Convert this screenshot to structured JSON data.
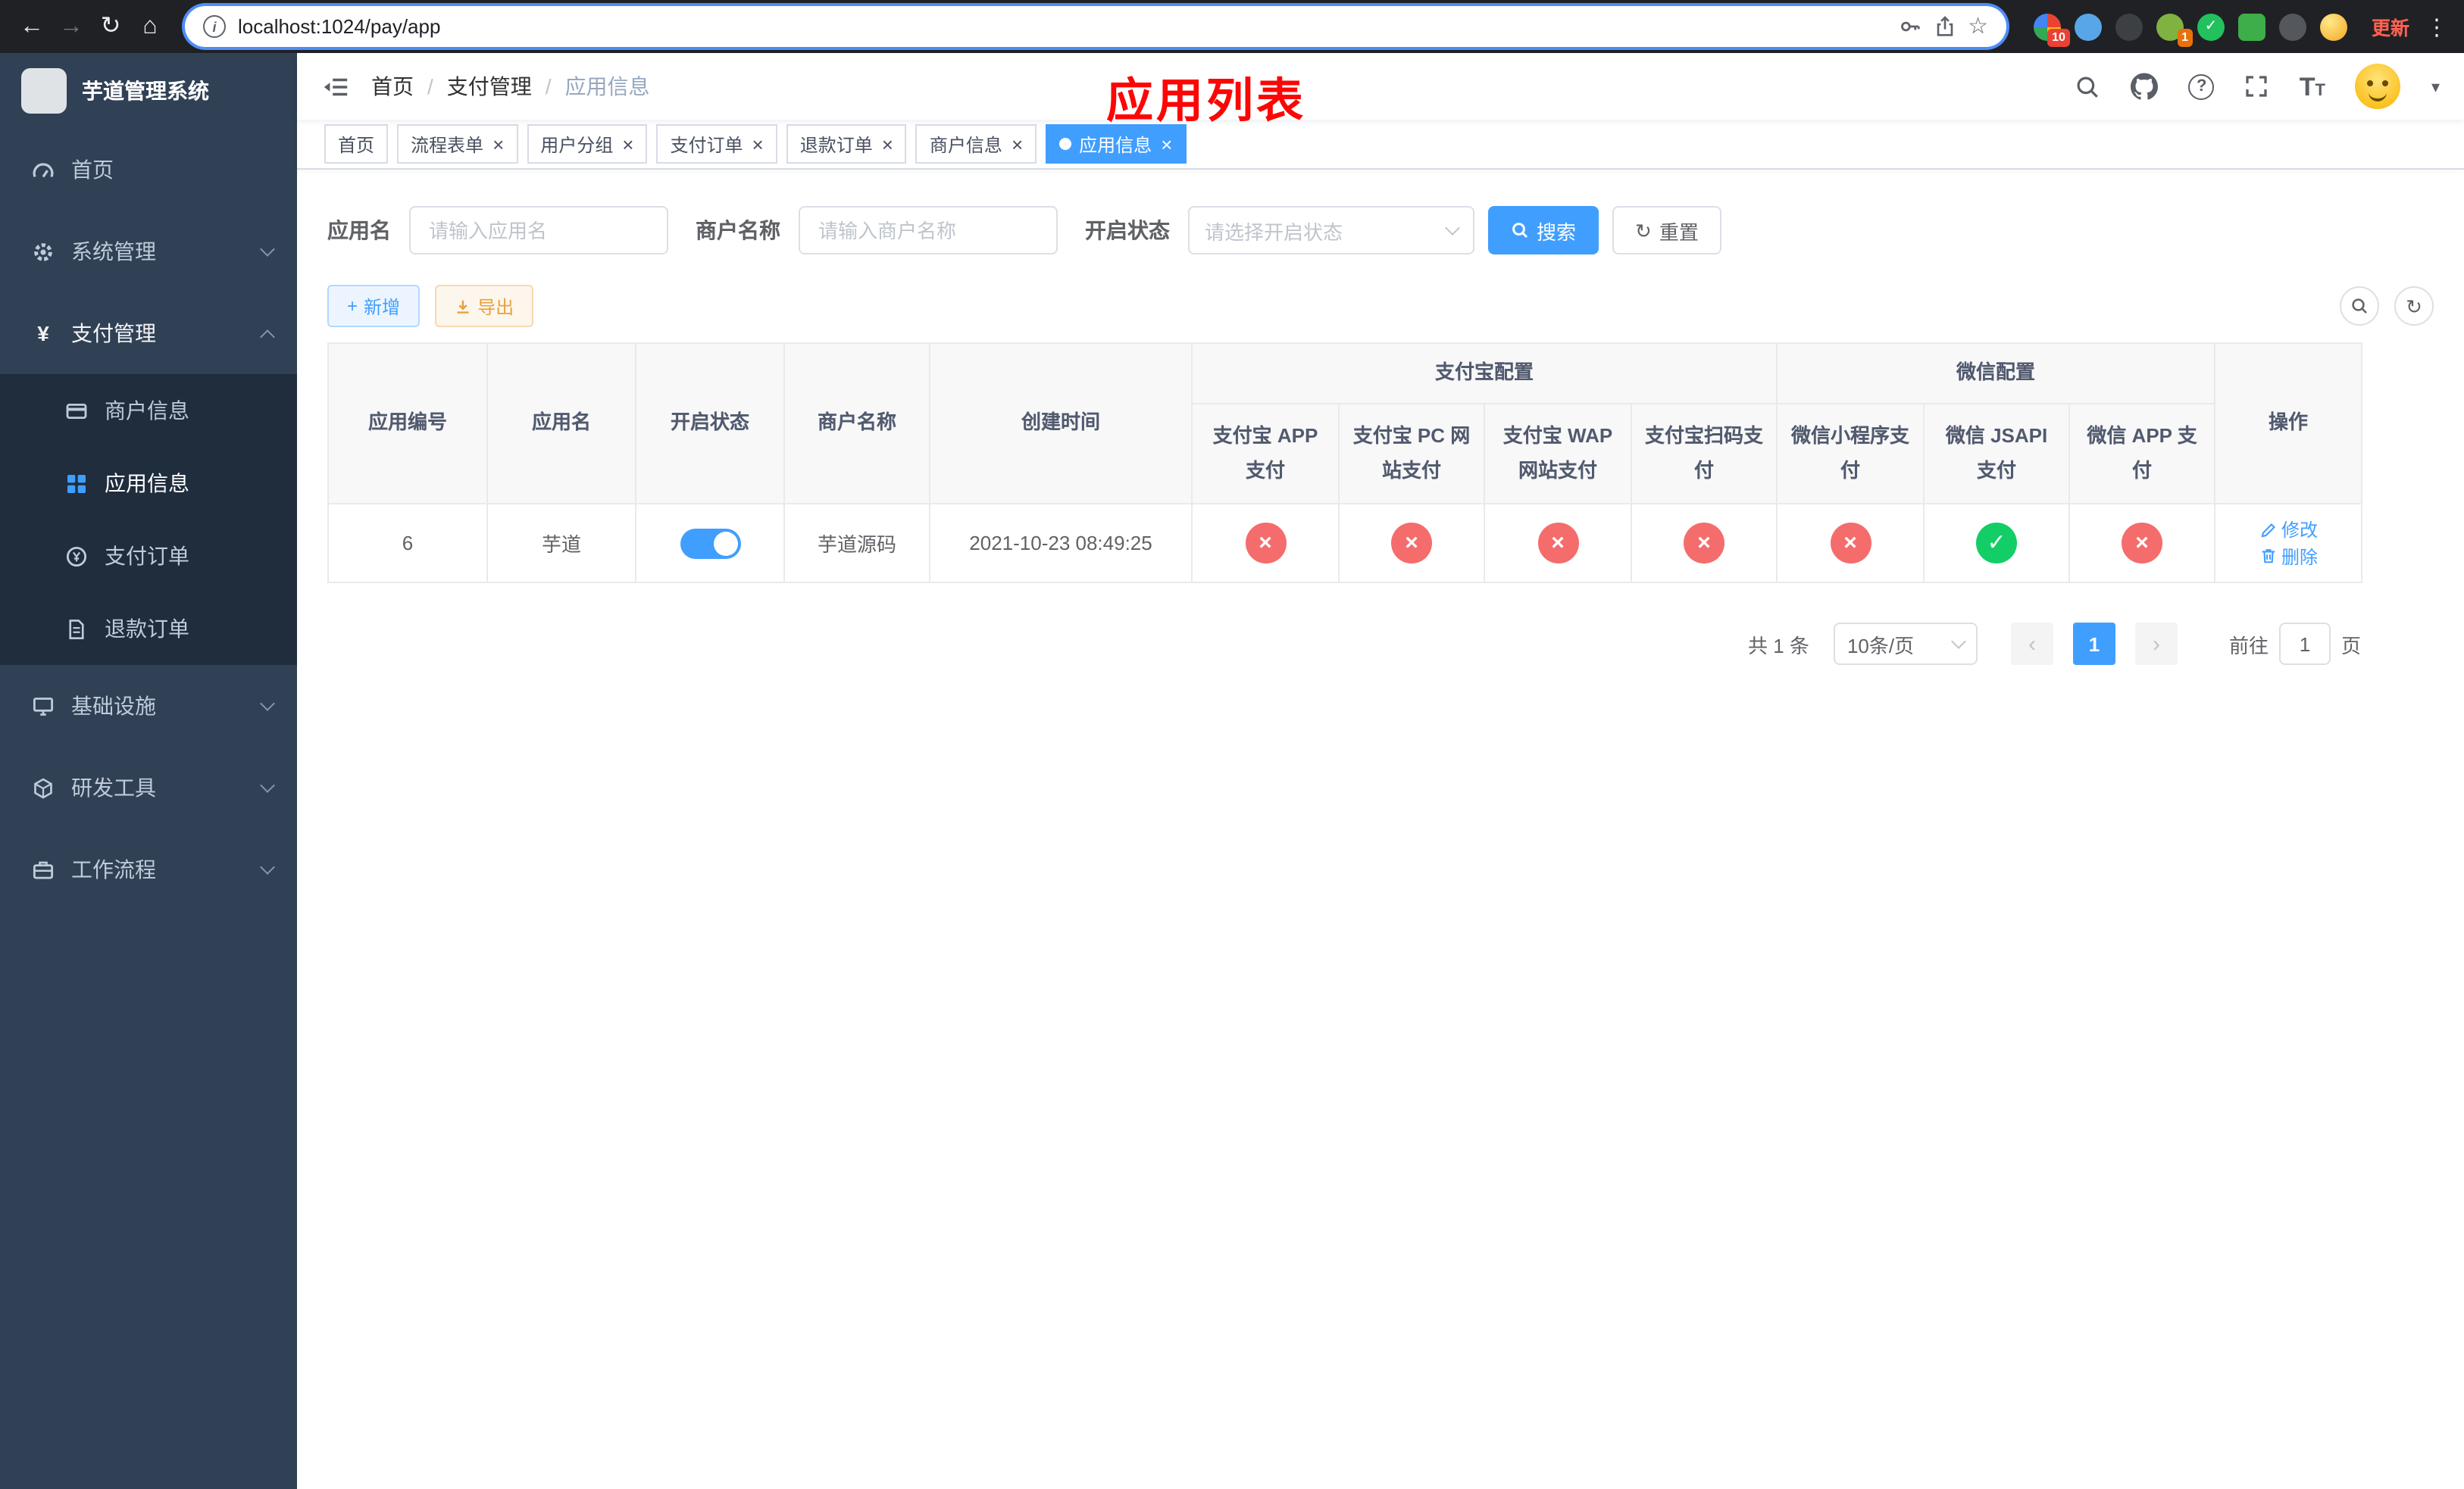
{
  "colors": {
    "accent": "#409eff",
    "success": "#13ce66",
    "danger": "#f56c6c",
    "warning": "#e6a23c"
  },
  "icons": {
    "back": "←",
    "forward": "→",
    "reload": "↻",
    "home": "⌂",
    "menu_dots": "⋮",
    "star": "☆",
    "info": "i",
    "question": "?",
    "plus": "+",
    "refresh": "↻",
    "check": "✓",
    "cross": "×",
    "caret_down": "▾",
    "yen": "¥",
    "prev": "‹",
    "next": "›"
  },
  "browser": {
    "url": "localhost:1024/pay/app",
    "update_label": "更新",
    "extension_badges": [
      "10",
      "1"
    ]
  },
  "sidebar": {
    "title": "芋道管理系统",
    "home": "首页",
    "system": "系统管理",
    "payment": "支付管理",
    "merchant_info": "商户信息",
    "app_info": "应用信息",
    "pay_order": "支付订单",
    "refund_order": "退款订单",
    "infra": "基础设施",
    "dev_tools": "研发工具",
    "workflow": "工作流程"
  },
  "navbar": {
    "breadcrumb": {
      "home": "首页",
      "section": "支付管理",
      "current": "应用信息"
    }
  },
  "annotation": {
    "title": "应用列表",
    "color": "#fe0505"
  },
  "tabs": {
    "home": "首页",
    "process_form": "流程表单",
    "user_group": "用户分组",
    "pay_order": "支付订单",
    "refund_order": "退款订单",
    "merchant_info": "商户信息",
    "app_info": "应用信息"
  },
  "filters": {
    "app_name_label": "应用名",
    "app_name_placeholder": "请输入应用名",
    "merchant_label": "商户名称",
    "merchant_placeholder": "请输入商户名称",
    "status_label": "开启状态",
    "status_placeholder": "请选择开启状态",
    "search": "搜索",
    "reset": "重置"
  },
  "toolbar": {
    "add": "新增",
    "export": "导出"
  },
  "table": {
    "headers": {
      "app_id": "应用编号",
      "app_name": "应用名",
      "status": "开启状态",
      "merchant": "商户名称",
      "create_time": "创建时间",
      "alipay_group": "支付宝配置",
      "wechat_group": "微信配置",
      "alipay_app": "支付宝 APP 支付",
      "alipay_pc": "支付宝 PC 网站支付",
      "alipay_wap": "支付宝 WAP 网站支付",
      "alipay_qr": "支付宝扫码支付",
      "wx_lite": "微信小程序支付",
      "wx_jsapi": "微信 JSAPI 支付",
      "wx_app": "微信 APP 支付",
      "actions": "操作"
    },
    "rows": [
      {
        "app_id": "6",
        "app_name": "芋道",
        "status_on": true,
        "merchant": "芋道源码",
        "create_time": "2021-10-23 08:49:25",
        "channels": {
          "alipay_app": false,
          "alipay_pc": false,
          "alipay_wap": false,
          "alipay_qr": false,
          "wx_lite": false,
          "wx_jsapi": true,
          "wx_app": false
        },
        "edit": "修改",
        "delete": "删除"
      }
    ]
  },
  "pagination": {
    "total": "共 1 条",
    "page_size": "10条/页",
    "page": "1",
    "goto_label": "前往",
    "goto_value": "1",
    "page_unit": "页"
  }
}
